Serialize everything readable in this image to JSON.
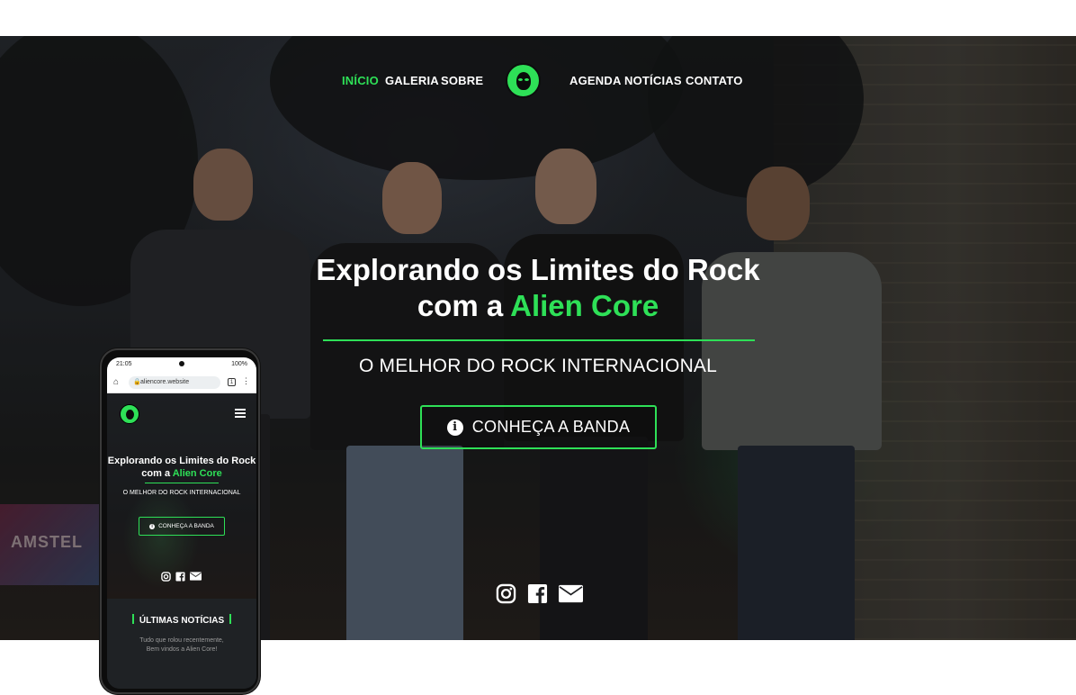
{
  "nav": {
    "left_items": [
      {
        "label": "INÍCIO",
        "active": true
      },
      {
        "label": "GALERIA",
        "active": false
      },
      {
        "label": "SOBRE",
        "active": false
      }
    ],
    "right_items": [
      {
        "label": "AGENDA",
        "active": false
      },
      {
        "label": "NOTÍCIAS",
        "active": false
      },
      {
        "label": "CONTATO",
        "active": false
      }
    ],
    "logo_icon": "alien-core-logo-icon"
  },
  "hero": {
    "headline_line1": "Explorando os Limites do Rock",
    "headline_line2_prefix": "com a ",
    "headline_line2_highlight": "Alien Core",
    "tagline": "O MELHOR DO ROCK INTERNACIONAL",
    "cta_label": "CONHEÇA A BANDA",
    "cta_icon": "info-circle-icon",
    "social_icons": [
      "instagram-icon",
      "facebook-icon",
      "envelope-icon"
    ],
    "background_sign_text": "AMSTEL"
  },
  "mobile": {
    "status_time": "21:05",
    "status_battery": "100%",
    "url": "aliencore.website",
    "tab_count": "1",
    "headline_line1": "Explorando os Limites do Rock",
    "headline_line2_prefix": "com a ",
    "headline_line2_highlight": "Alien Core",
    "tagline": "O MELHOR DO ROCK INTERNACIONAL",
    "cta_label": "CONHEÇA A BANDA",
    "news_title": "ÚLTIMAS NOTÍCIAS",
    "news_sub_line1": "Tudo que rolou recentemente,",
    "news_sub_line2": "Bem vindos a Alien Core!"
  },
  "colors": {
    "accent": "#2ee057",
    "text": "#ffffff",
    "dark_panel": "#1f2225"
  }
}
